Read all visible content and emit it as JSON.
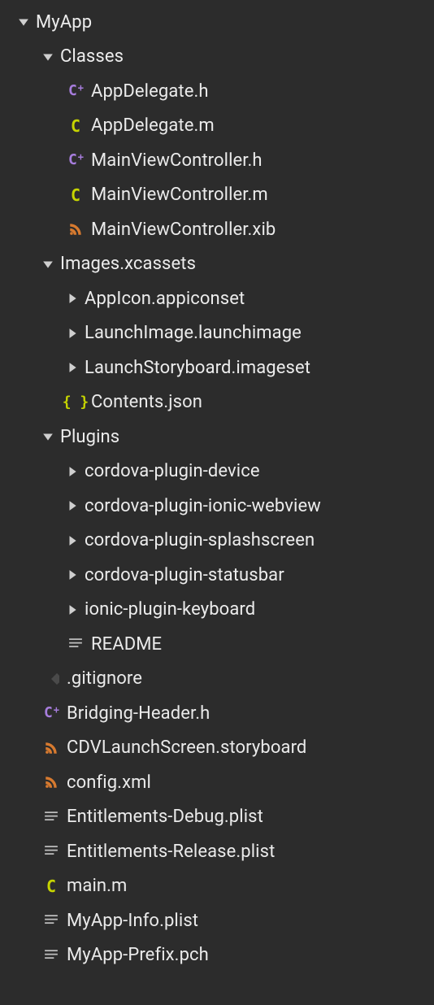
{
  "root": {
    "name": "MyApp",
    "children": [
      {
        "name": "Classes",
        "type": "folder",
        "expanded": true,
        "children": [
          {
            "name": "AppDelegate.h",
            "icon": "cpp"
          },
          {
            "name": "AppDelegate.m",
            "icon": "c"
          },
          {
            "name": "MainViewController.h",
            "icon": "cpp"
          },
          {
            "name": "MainViewController.m",
            "icon": "c"
          },
          {
            "name": "MainViewController.xib",
            "icon": "rss"
          }
        ]
      },
      {
        "name": "Images.xcassets",
        "type": "folder",
        "expanded": true,
        "children": [
          {
            "name": "AppIcon.appiconset",
            "type": "folder",
            "expanded": false
          },
          {
            "name": "LaunchImage.launchimage",
            "type": "folder",
            "expanded": false
          },
          {
            "name": "LaunchStoryboard.imageset",
            "type": "folder",
            "expanded": false
          },
          {
            "name": "Contents.json",
            "icon": "braces"
          }
        ]
      },
      {
        "name": "Plugins",
        "type": "folder",
        "expanded": true,
        "children": [
          {
            "name": "cordova-plugin-device",
            "type": "folder",
            "expanded": false
          },
          {
            "name": "cordova-plugin-ionic-webview",
            "type": "folder",
            "expanded": false
          },
          {
            "name": "cordova-plugin-splashscreen",
            "type": "folder",
            "expanded": false
          },
          {
            "name": "cordova-plugin-statusbar",
            "type": "folder",
            "expanded": false
          },
          {
            "name": "ionic-plugin-keyboard",
            "type": "folder",
            "expanded": false
          },
          {
            "name": "README",
            "icon": "lines"
          }
        ]
      },
      {
        "name": ".gitignore",
        "icon": "git"
      },
      {
        "name": "Bridging-Header.h",
        "icon": "cpp"
      },
      {
        "name": "CDVLaunchScreen.storyboard",
        "icon": "rss"
      },
      {
        "name": "config.xml",
        "icon": "rss"
      },
      {
        "name": "Entitlements-Debug.plist",
        "icon": "lines"
      },
      {
        "name": "Entitlements-Release.plist",
        "icon": "lines"
      },
      {
        "name": "main.m",
        "icon": "c"
      },
      {
        "name": "MyApp-Info.plist",
        "icon": "lines"
      },
      {
        "name": "MyApp-Prefix.pch",
        "icon": "lines"
      }
    ]
  },
  "icons": {
    "cpp": "C⁺",
    "c": "C",
    "braces": "{ }"
  }
}
